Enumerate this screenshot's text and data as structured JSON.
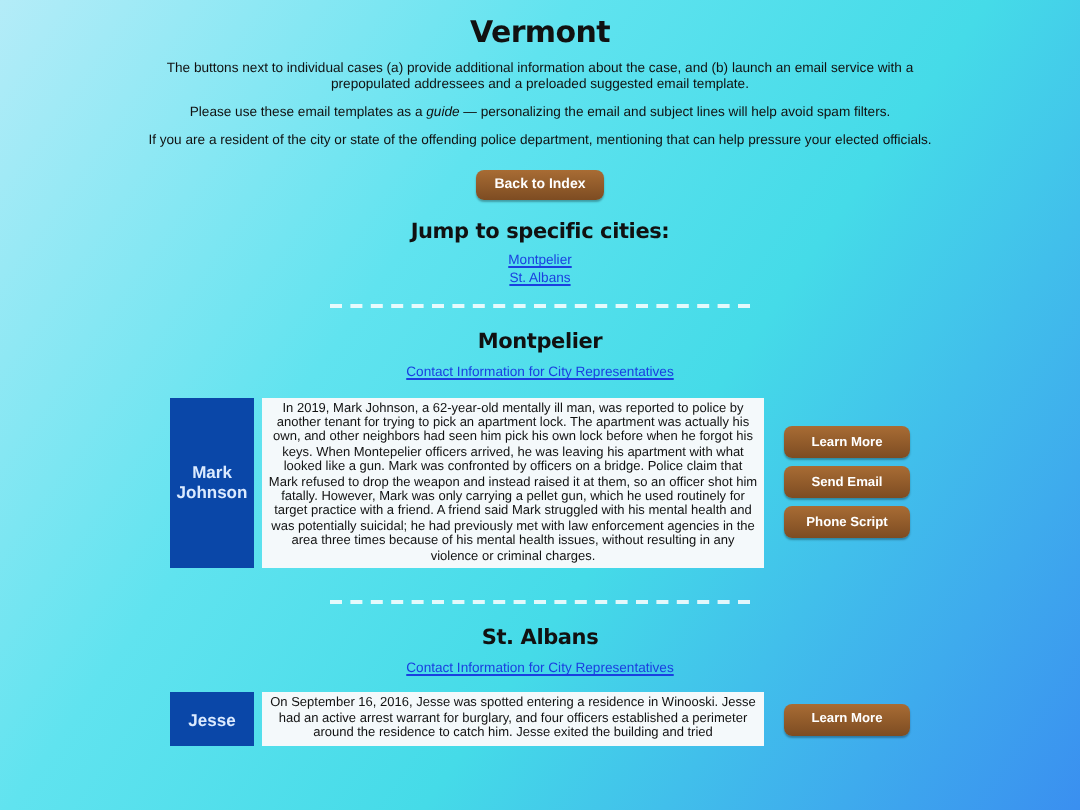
{
  "title": "Vermont",
  "intro": [
    "The buttons next to individual cases (a) provide additional information about the case, and (b) launch an email service with a prepopulated addressees and a preloaded suggested email template.",
    "Please use these email templates as a *guide* — personalizing the email and subject lines will help avoid spam filters.",
    "If you are a resident of the city or state of the offending police department, mentioning that can help pressure your elected officials."
  ],
  "back_button": "Back to Index",
  "jump": {
    "heading": "Jump to specific cities:",
    "links": [
      "Montpelier",
      "St. Albans"
    ]
  },
  "cities": [
    {
      "name": "Montpelier",
      "contact_link": "Contact Information for City Representatives",
      "cases": [
        {
          "name": "Mark Johnson",
          "story": "In 2019, Mark Johnson, a 62-year-old mentally ill man, was reported to police by another tenant for trying to pick an apartment lock. The apartment was actually his own, and other neighbors had seen him pick his own lock before when he forgot his keys. When Montepelier officers arrived, he was leaving his apartment with what looked like a gun. Mark was confronted by officers on a bridge. Police claim that Mark refused to drop the weapon and instead raised it at them, so an officer shot him fatally. However, Mark was only carrying a pellet gun, which he used routinely for target practice with a friend. A friend said Mark struggled with his mental health and was potentially suicidal; he had previously met with law enforcement agencies in the area three times because of his mental health issues, without resulting in any violence or criminal charges.",
          "buttons": [
            "Learn More",
            "Send Email",
            "Phone Script"
          ]
        }
      ]
    },
    {
      "name": "St. Albans",
      "contact_link": "Contact Information for City Representatives",
      "cases": [
        {
          "name": "Jesse",
          "story": "On September 16, 2016, Jesse was spotted entering a residence in Winooski. Jesse had an active arrest warrant for burglary, and four officers established a perimeter around the residence to catch him. Jesse exited the building and tried",
          "buttons": [
            "Learn More"
          ]
        }
      ]
    }
  ]
}
